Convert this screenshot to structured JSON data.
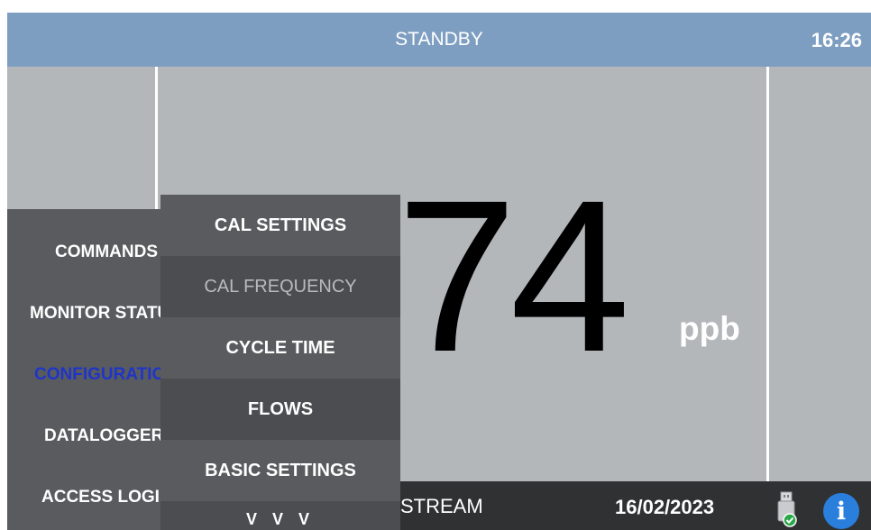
{
  "header": {
    "status": "STANDBY",
    "time": "16:26"
  },
  "reading": {
    "value": "74",
    "unit": "ppb"
  },
  "footer": {
    "stream": "STREAM",
    "date": "16/02/2023"
  },
  "icons": {
    "usb": "usb-drive-icon",
    "info": "info-icon",
    "info_glyph": "i"
  },
  "colors": {
    "header_bg": "#7e9ec1",
    "screen_bg": "#b3b7ba",
    "menu_bg": "#595b5e",
    "menu_active_text": "#1f35c9",
    "footer_bg": "#2f3133",
    "info_blue": "#2b7fdc"
  },
  "menu": {
    "main_items": [
      {
        "label": "COMMANDS",
        "active": false
      },
      {
        "label": "MONITOR STATUS",
        "active": false
      },
      {
        "label": "CONFIGURATION",
        "active": true
      },
      {
        "label": "DATALOGGER",
        "active": false
      },
      {
        "label": "ACCESS LOGIN",
        "active": false
      }
    ],
    "sub_items": [
      {
        "label": "CAL SETTINGS",
        "disabled": false
      },
      {
        "label": "CAL FREQUENCY",
        "disabled": true
      },
      {
        "label": "CYCLE TIME",
        "disabled": false
      },
      {
        "label": "FLOWS",
        "disabled": false
      },
      {
        "label": "BASIC SETTINGS",
        "disabled": false
      }
    ],
    "more": "V V V"
  }
}
